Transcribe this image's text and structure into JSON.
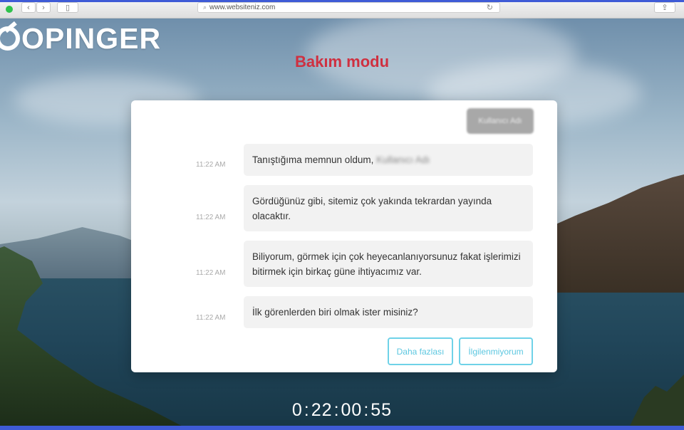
{
  "browser": {
    "url": "www.websiteniz.com",
    "back_glyph": "‹",
    "forward_glyph": "›",
    "reload_glyph": "↻",
    "search_glyph": "⌕",
    "share_glyph": "⇪",
    "sidebar_glyph": "▯"
  },
  "brand": {
    "name": "OPINGER",
    "color": "#ffffff"
  },
  "page": {
    "title": "Bakım modu",
    "title_color": "#cf3040"
  },
  "chat": {
    "user_message": "Kullanıcı Adı",
    "messages": [
      {
        "time": "11:22 AM",
        "text_prefix": "Tanıştığıma memnun oldum, ",
        "blurred_name": "Kullanıcı Adı"
      },
      {
        "time": "11:22 AM",
        "text": "Gördüğünüz gibi, sitemiz çok yakında tekrardan yayında olacaktır."
      },
      {
        "time": "11:22 AM",
        "text": "Biliyorum, görmek için çok heyecanlanıyorsunuz fakat işlerimizi bitirmek için birkaç güne ihtiyacımız var."
      },
      {
        "time": "11:22 AM",
        "text": "İlk görenlerden biri olmak ister misiniz?"
      }
    ],
    "actions": {
      "more": "Daha fazlası",
      "not_interested": "İlgilenmiyorum"
    },
    "accent": "#5cc7e0"
  },
  "countdown": {
    "days": "0",
    "hours": "22",
    "minutes": "00",
    "seconds": "55"
  }
}
